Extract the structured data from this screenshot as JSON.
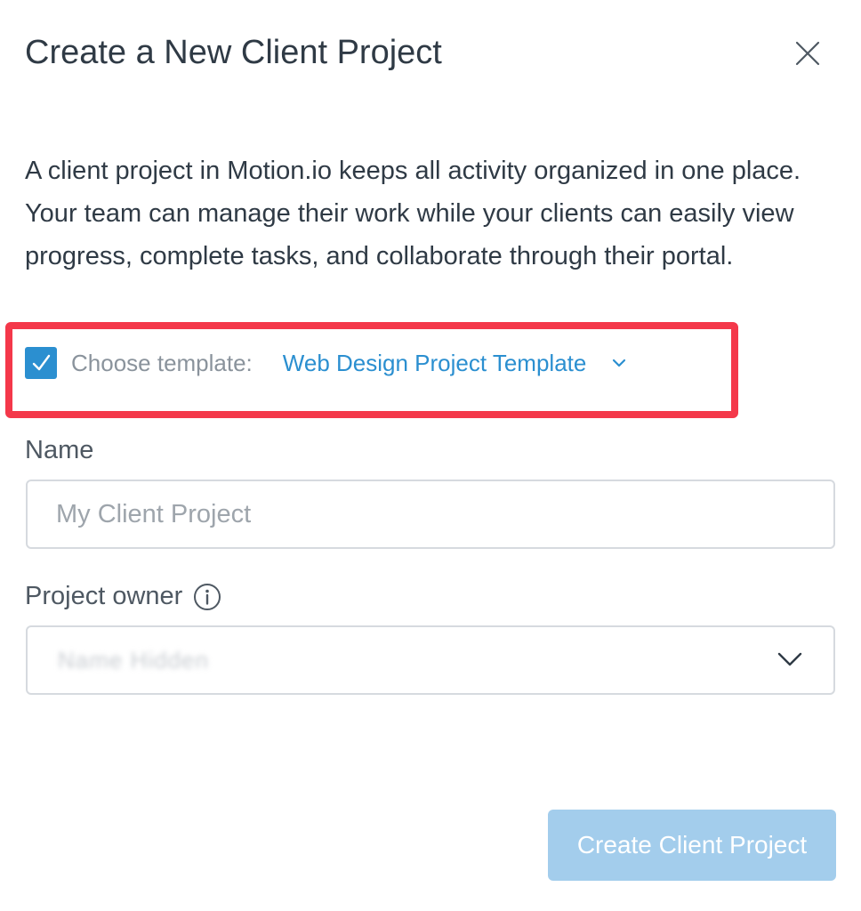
{
  "dialog": {
    "title": "Create a New Client Project",
    "description": "A client project in Motion.io keeps all activity organized in one place. Your team can manage their work while your clients can easily view progress, complete tasks, and collaborate through their portal."
  },
  "template": {
    "checked": true,
    "label": "Choose template:",
    "selected": "Web Design Project Template"
  },
  "name_field": {
    "label": "Name",
    "placeholder": "My Client Project",
    "value": ""
  },
  "owner_field": {
    "label": "Project owner",
    "selected": "Name Hidden"
  },
  "actions": {
    "create_label": "Create Client Project"
  },
  "colors": {
    "accent": "#2b8fd0",
    "highlight": "#f4384a",
    "button_disabled": "#a3cdec"
  },
  "icons": {
    "close": "close-icon",
    "check": "checkmark-icon",
    "template_dropdown": "chevron-down-icon",
    "info": "info-icon",
    "owner_dropdown": "chevron-down-icon"
  }
}
